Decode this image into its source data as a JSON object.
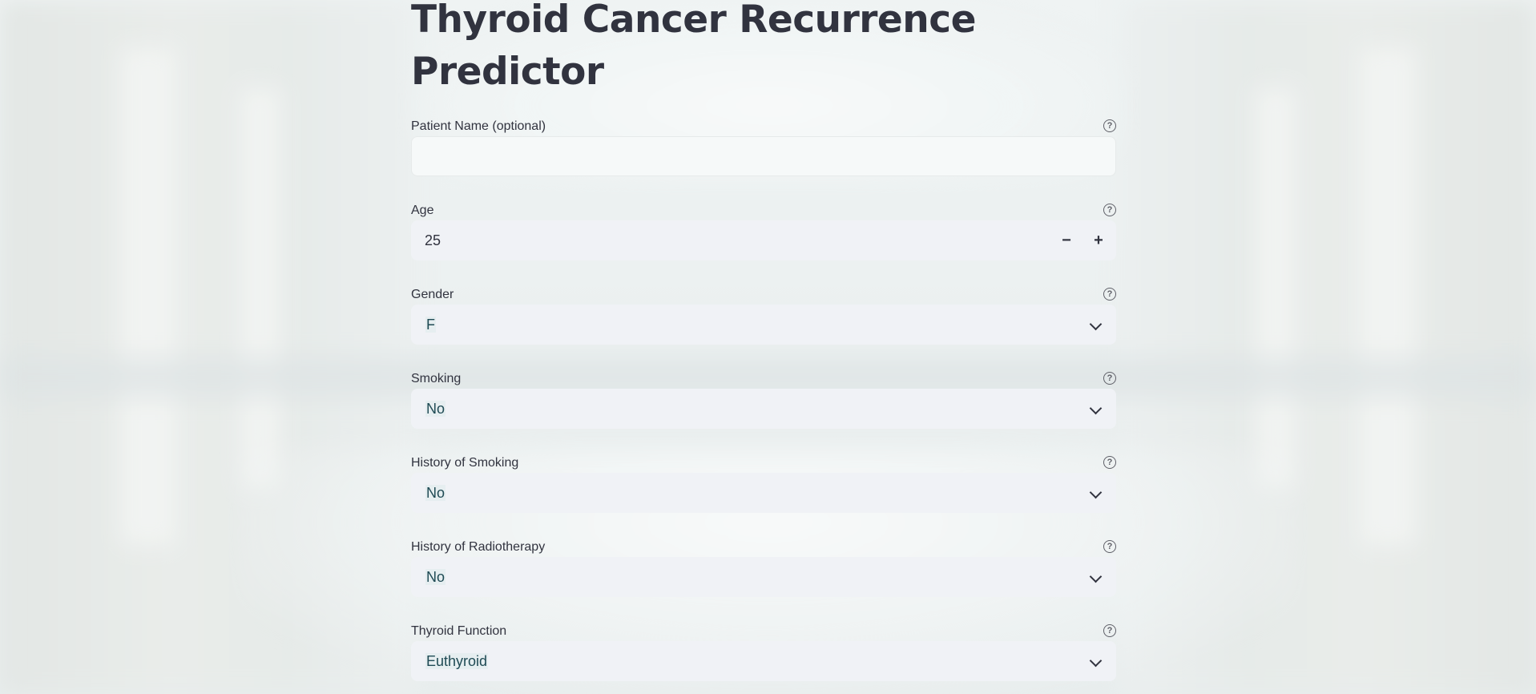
{
  "page": {
    "title": "Thyroid Cancer Recurrence Predictor"
  },
  "form": {
    "patient_name": {
      "label": "Patient Name (optional)",
      "value": "",
      "help": "?"
    },
    "age": {
      "label": "Age",
      "value": "25",
      "decrement": "−",
      "increment": "+",
      "help": "?"
    },
    "gender": {
      "label": "Gender",
      "selected": "F",
      "help": "?"
    },
    "smoking": {
      "label": "Smoking",
      "selected": "No",
      "help": "?"
    },
    "history_smoking": {
      "label": "History of Smoking",
      "selected": "No",
      "help": "?"
    },
    "history_radiotherapy": {
      "label": "History of Radiotherapy",
      "selected": "No",
      "help": "?"
    },
    "thyroid_function": {
      "label": "Thyroid Function",
      "selected": "Euthyroid",
      "help": "?"
    }
  },
  "icons": {
    "help": "question-circle-icon",
    "dropdown": "chevron-down-icon"
  },
  "colors": {
    "text": "#31333f",
    "input_bg": "#f0f2f6",
    "selected_text": "#1f4a54"
  }
}
